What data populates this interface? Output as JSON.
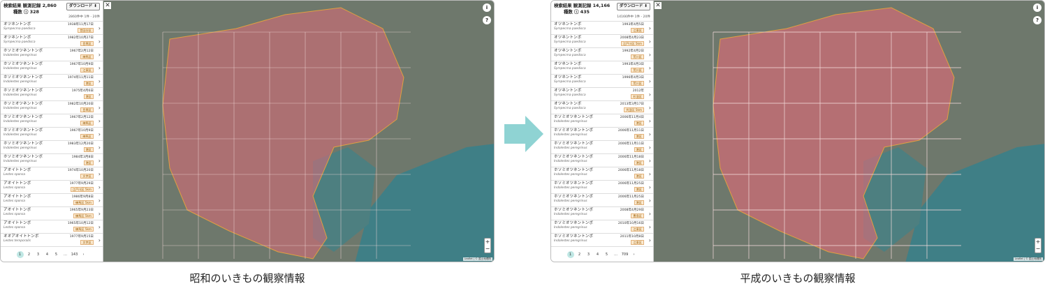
{
  "left": {
    "title": "検索結果 観測記録 2,860",
    "species": "種数 ⓘ 328",
    "download": "ダウンロード ⬇",
    "range": "2860件中 1件 - 20件",
    "close": "✕",
    "items": [
      {
        "jp": "オツネントンボ",
        "sci": "Sympecma paedisca",
        "date": "1938年11月17日",
        "ward": "世田谷区"
      },
      {
        "jp": "オツネントンボ",
        "sci": "Sympecma paedisca",
        "date": "1982年10月27日",
        "ward": "目黒区"
      },
      {
        "jp": "ホソミオツネントンボ",
        "sci": "Indolestes peregrinus",
        "date": "1967年2月12日",
        "ward": "練馬区"
      },
      {
        "jp": "ホソミオツネントンボ",
        "sci": "Indolestes peregrinus",
        "date": "1967年10月9日",
        "ward": "江東区"
      },
      {
        "jp": "ホソミオツネントンボ",
        "sci": "Indolestes peregrinus",
        "date": "1974年11月11日",
        "ward": "港区"
      },
      {
        "jp": "ホソミオツネントンボ",
        "sci": "Indolestes peregrinus",
        "date": "1975年4月6日",
        "ward": "港区"
      },
      {
        "jp": "ホソミオツネントンボ",
        "sci": "Indolestes peregrinus",
        "date": "1982年10月20日",
        "ward": "目黒区"
      },
      {
        "jp": "ホソミオツネントンボ",
        "sci": "Indolestes peregrinus",
        "date": "1967年2月12日",
        "ward": "練馬区"
      },
      {
        "jp": "ホソミオツネントンボ",
        "sci": "Indolestes peregrinus",
        "date": "1967年10月9日",
        "ward": "練馬区"
      },
      {
        "jp": "ホソミオツネントンボ",
        "sci": "Indolestes peregrinus",
        "date": "1983年12月20日",
        "ward": "港区"
      },
      {
        "jp": "ホソミオツネントンボ",
        "sci": "Indolestes peregrinus",
        "date": "1984年3月8日",
        "ward": "港区"
      },
      {
        "jp": "アオイトトンボ",
        "sci": "Lestes sponsa",
        "date": "1974年10月20日",
        "ward": "文京区"
      },
      {
        "jp": "アオイトトンボ",
        "sci": "Lestes sponsa",
        "date": "1977年9月29日",
        "ward": "江戸川区 5km"
      },
      {
        "jp": "アオイトトンボ",
        "sci": "Lestes sponsa",
        "date": "1986年9月8日",
        "ward": "練馬区 5km"
      },
      {
        "jp": "アオイトトンボ",
        "sci": "Lestes sponsa",
        "date": "1965年9月23日",
        "ward": "練馬区 5km"
      },
      {
        "jp": "アオイトトンボ",
        "sci": "Lestes sponsa",
        "date": "1965年10月12日",
        "ward": "練馬区 5km"
      },
      {
        "jp": "オオアオイトトンボ",
        "sci": "Lestes temporalis",
        "date": "1977年9月15日",
        "ward": "文京区"
      }
    ],
    "pages": [
      "1",
      "2",
      "3",
      "4",
      "5",
      "…",
      "143",
      "›"
    ],
    "caption": "昭和のいきもの観察情報"
  },
  "right": {
    "title": "検索結果 観測記録 14,166",
    "species": "種数 ⓘ 435",
    "download": "ダウンロード ⬇",
    "range": "14166件中 1件 - 20件",
    "close": "✕",
    "items": [
      {
        "jp": "オツネントンボ",
        "sci": "Sympecma paedisca",
        "date": "1993年4月5日",
        "ward": "江東区"
      },
      {
        "jp": "オツネントンボ",
        "sci": "Sympecma paedisca",
        "date": "2008年4月23日",
        "ward": "江戸川区 5km"
      },
      {
        "jp": "オツネントンボ",
        "sci": "Sympecma paedisca",
        "date": "1992年4月2日",
        "ward": "荒川区"
      },
      {
        "jp": "オツネントンボ",
        "sci": "Sympecma paedisca",
        "date": "1993年4月3日",
        "ward": "荒川区"
      },
      {
        "jp": "オツネントンボ",
        "sci": "Sympecma paedisca",
        "date": "1996年4月3日",
        "ward": "荒川区"
      },
      {
        "jp": "オツネントンボ",
        "sci": "Sympecma paedisca",
        "date": "2012年",
        "ward": "杉並区"
      },
      {
        "jp": "オツネントンボ",
        "sci": "Sympecma paedisca",
        "date": "2013年3月17日",
        "ward": "大田区 5km"
      },
      {
        "jp": "ホソミオツネントンボ",
        "sci": "Indolestes peregrinus",
        "date": "2006年11月4日",
        "ward": "港区"
      },
      {
        "jp": "ホソミオツネントンボ",
        "sci": "Indolestes peregrinus",
        "date": "2006年11月11日",
        "ward": "港区"
      },
      {
        "jp": "ホソミオツネントンボ",
        "sci": "Indolestes peregrinus",
        "date": "2006年11月11日",
        "ward": "港区"
      },
      {
        "jp": "ホソミオツネントンボ",
        "sci": "Indolestes peregrinus",
        "date": "2006年11月18日",
        "ward": "港区"
      },
      {
        "jp": "ホソミオツネントンボ",
        "sci": "Indolestes peregrinus",
        "date": "2006年11月18日",
        "ward": "港区"
      },
      {
        "jp": "ホソミオツネントンボ",
        "sci": "Indolestes peregrinus",
        "date": "2006年11月25日",
        "ward": "港区"
      },
      {
        "jp": "ホソミオツネントンボ",
        "sci": "Indolestes peregrinus",
        "date": "2006年11月25日",
        "ward": "港区"
      },
      {
        "jp": "ホソミオツネントンボ",
        "sci": "Indolestes peregrinus",
        "date": "2008年4月29日",
        "ward": "豊島区"
      },
      {
        "jp": "ホソミオツネントンボ",
        "sci": "Indolestes peregrinus",
        "date": "2010年10月16日",
        "ward": "江東区"
      },
      {
        "jp": "ホソミオツネントンボ",
        "sci": "Indolestes peregrinus",
        "date": "2011年10月8日",
        "ward": "江東区"
      }
    ],
    "pages": [
      "1",
      "2",
      "3",
      "4",
      "5",
      "…",
      "709",
      "›"
    ],
    "caption": "平成のいきもの観察情報"
  },
  "map": {
    "attribution": "Leaflet | © 国土地理院",
    "zoom_in": "+",
    "zoom_out": "−",
    "info": "i",
    "help": "?"
  },
  "colors": {
    "region_fill": "#e06a78",
    "grid": "#f3d9d9",
    "accent": "#bfe7e4",
    "arrow": "#8fd3d3"
  }
}
